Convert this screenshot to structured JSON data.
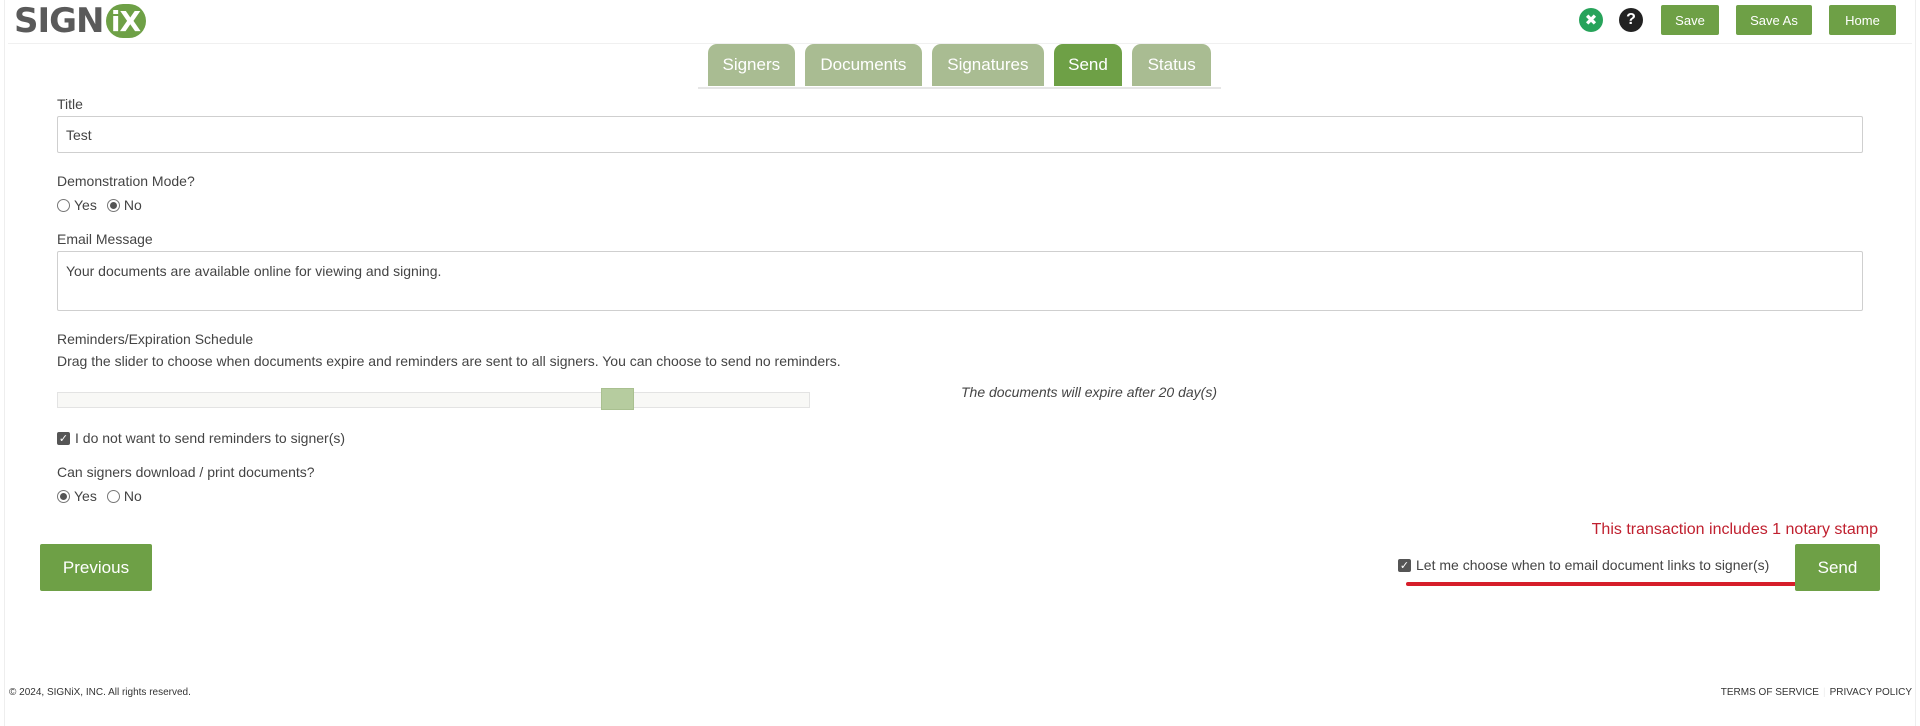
{
  "header": {
    "logo_text": "SIGN",
    "logo_badge": "iX",
    "tools_icon": "tools-icon",
    "help_icon": "help-icon",
    "help_glyph": "?",
    "buttons": {
      "save": "Save",
      "save_as": "Save As",
      "home": "Home"
    }
  },
  "tabs": [
    {
      "label": "Signers",
      "active": false
    },
    {
      "label": "Documents",
      "active": false
    },
    {
      "label": "Signatures",
      "active": false
    },
    {
      "label": "Send",
      "active": true
    },
    {
      "label": "Status",
      "active": false
    }
  ],
  "form": {
    "title_label": "Title",
    "title_value": "Test",
    "demo_label": "Demonstration Mode?",
    "demo_options": {
      "yes": "Yes",
      "no": "No",
      "selected": "No"
    },
    "email_label": "Email Message",
    "email_value": "Your documents are available online for viewing and signing.",
    "reminders_label": "Reminders/Expiration Schedule",
    "reminders_help": "Drag the slider to choose when documents expire and reminders are sent to all signers. You can choose to send no reminders.",
    "expire_text": "The documents will expire after 20 day(s)",
    "slider_value_fraction": 0.755,
    "no_reminders_label": "I do not want to send reminders to signer(s)",
    "no_reminders_checked": true,
    "download_label": "Can signers download / print documents?",
    "download_options": {
      "yes": "Yes",
      "no": "No",
      "selected": "Yes"
    }
  },
  "actions": {
    "notary_notice": "This transaction includes 1 notary stamp",
    "previous": "Previous",
    "let_me_choose": "Let me choose when to email document links to signer(s)",
    "let_me_choose_checked": true,
    "send": "Send"
  },
  "footer": {
    "copyright": "© 2024, SIGNiX, INC. All rights reserved.",
    "terms": "TERMS OF SERVICE",
    "privacy": "PRIVACY POLICY"
  },
  "colors": {
    "brand_green": "#6ea046",
    "tab_inactive": "#a9bc92",
    "notice_red": "#c0202f",
    "annotation_red": "#d61d2a"
  }
}
